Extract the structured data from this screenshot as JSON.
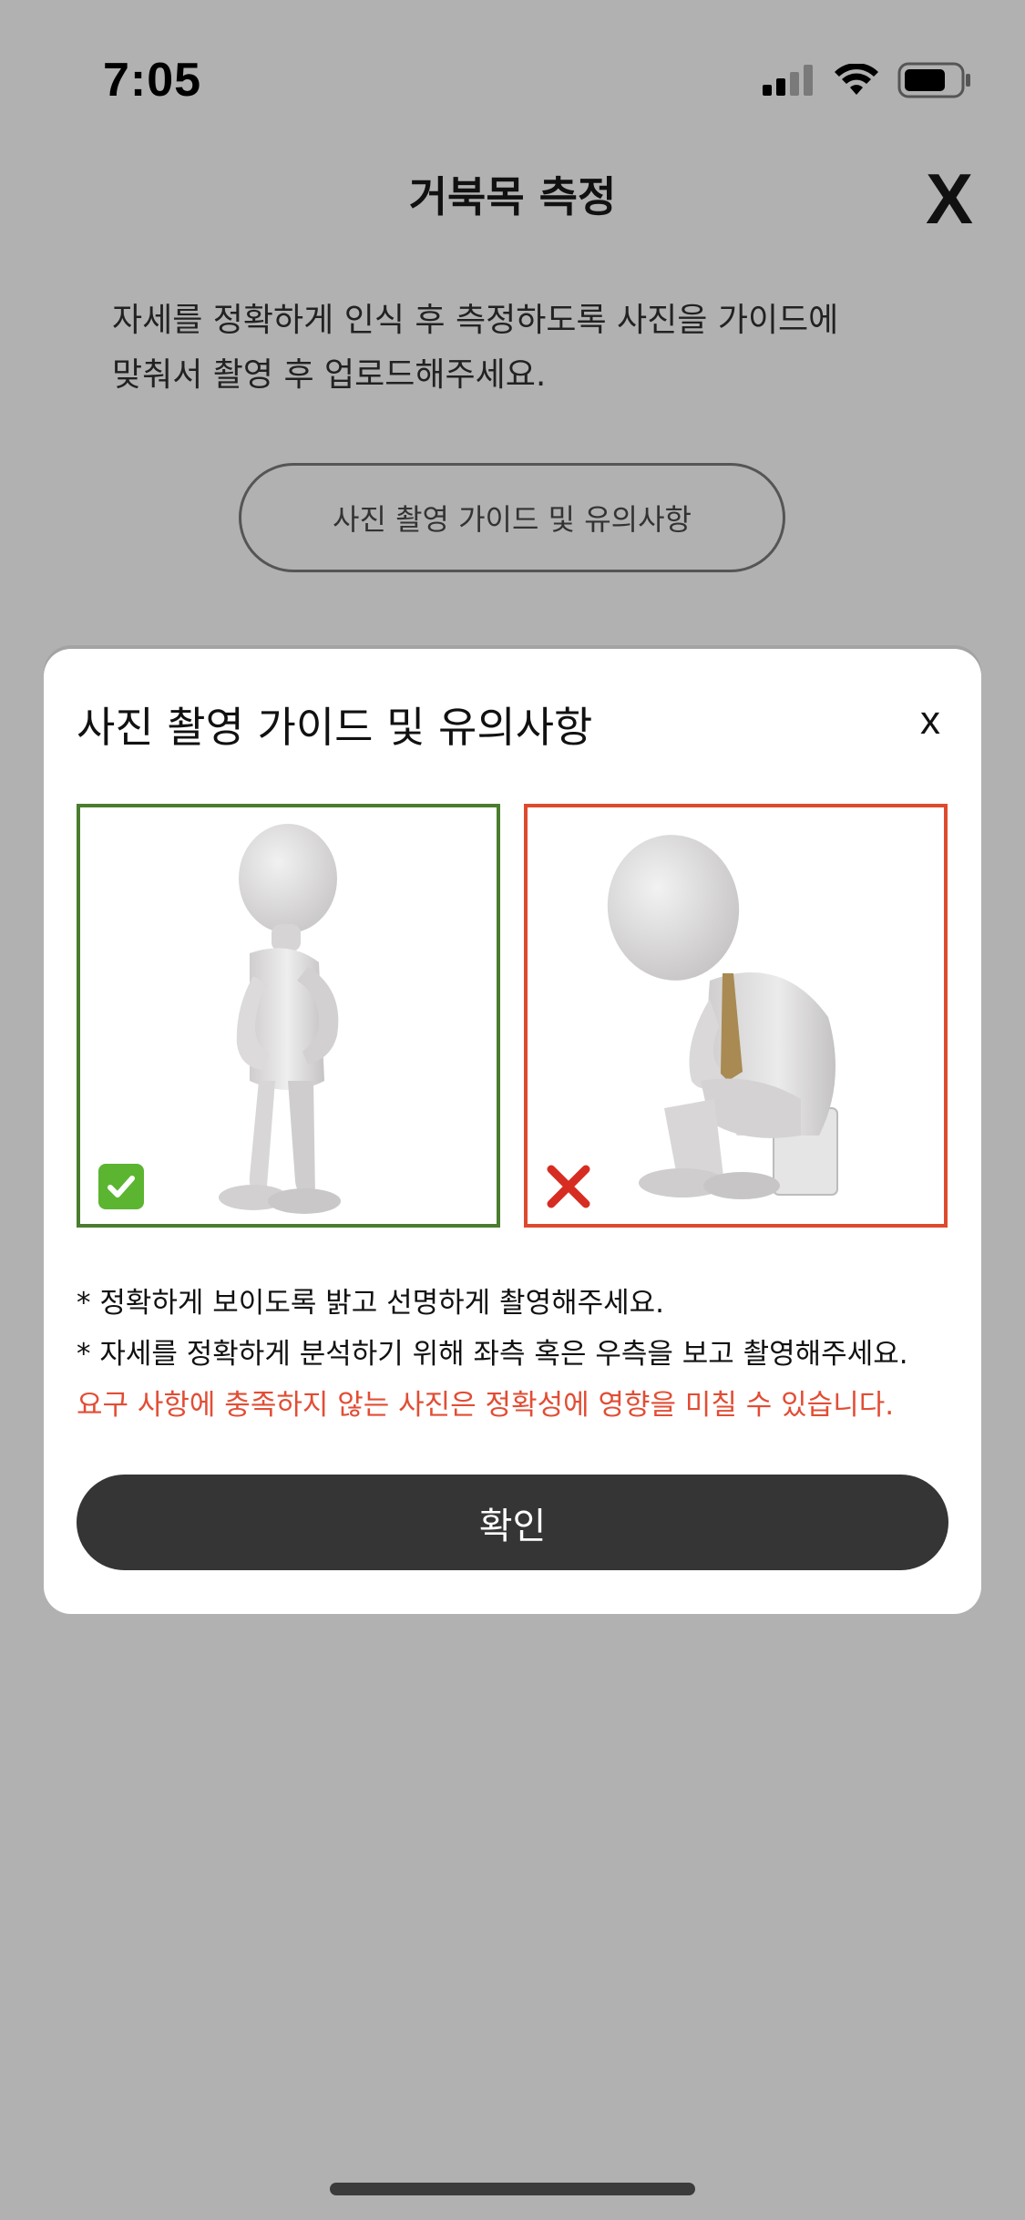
{
  "status_bar": {
    "time": "7:05",
    "icons": [
      "signal-icon",
      "wifi-icon",
      "battery-icon"
    ]
  },
  "page": {
    "title": "거북목 측정",
    "close_label": "X",
    "description": "자세를 정확하게 인식 후 측정하도록 사진을 가이드에\n맞춰서 촬영 후 업로드해주세요.",
    "guide_button_label": "사진 촬영 가이드 및 유의사항"
  },
  "modal": {
    "title": "사진 촬영 가이드 및 유의사항",
    "close_label": "x",
    "good_example": {
      "icon": "check-mark-icon",
      "color": "#4a7d2e"
    },
    "bad_example": {
      "icon": "cross-mark-icon",
      "color": "#de4a2d"
    },
    "notes": [
      "* 정확하게 보이도록 밝고 선명하게 촬영해주세요.",
      "* 자세를 정확하게 분석하기 위해 좌측 혹은 우측을 보고 촬영해주세요."
    ],
    "warning": "요구 사항에 충족하지 않는 사진은 정확성에 영향을 미칠 수 있습니다.",
    "warning_color": "#e24d34",
    "confirm_label": "확인"
  },
  "colors": {
    "backdrop": "#b1b1b1",
    "button_dark": "#353535"
  }
}
